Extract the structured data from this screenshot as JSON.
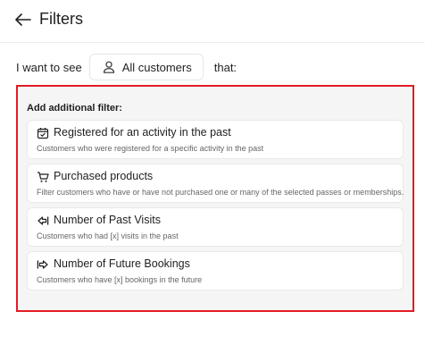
{
  "header": {
    "title": "Filters",
    "back_icon": "arrow-left-icon"
  },
  "audience_row": {
    "prefix": "I want to see",
    "selected": "All customers",
    "suffix": "that:",
    "icon": "person-icon"
  },
  "panel": {
    "title": "Add additional filter:",
    "border_color": "#e31b23",
    "filters": [
      {
        "icon": "calendar-check-icon",
        "title": "Registered for an activity in the past",
        "description": "Customers who were registered for a specific activity in the past"
      },
      {
        "icon": "cart-icon",
        "title": "Purchased products",
        "description": "Filter customers who have or have not purchased one or many of the selected passes or memberships."
      },
      {
        "icon": "past-visits-icon",
        "title": "Number of Past Visits",
        "description": "Customers who had [x] visits in the past"
      },
      {
        "icon": "future-bookings-icon",
        "title": "Number of Future Bookings",
        "description": "Customers who have [x] bookings in the future"
      }
    ]
  }
}
